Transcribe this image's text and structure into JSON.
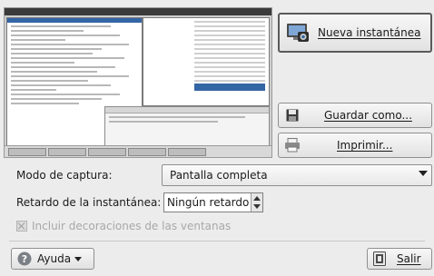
{
  "actions": {
    "new_snapshot": "Nueva instantánea",
    "save_as": "Guardar como...",
    "print": "Imprimir..."
  },
  "options": {
    "capture_mode_label": "Modo de captura:",
    "capture_mode_value": "Pantalla completa",
    "delay_label": "Retardo de la instantánea:",
    "delay_value": "Ningún retardo",
    "include_decorations_label": "Incluir decoraciones de las ventanas",
    "include_decorations_checked": false,
    "include_decorations_enabled": false
  },
  "footer": {
    "help": "Ayuda",
    "quit": "Salir"
  },
  "colors": {
    "accent": "#3465a4",
    "help_icon": "#7b7f86",
    "quit_icon": "#4a4a4a"
  }
}
